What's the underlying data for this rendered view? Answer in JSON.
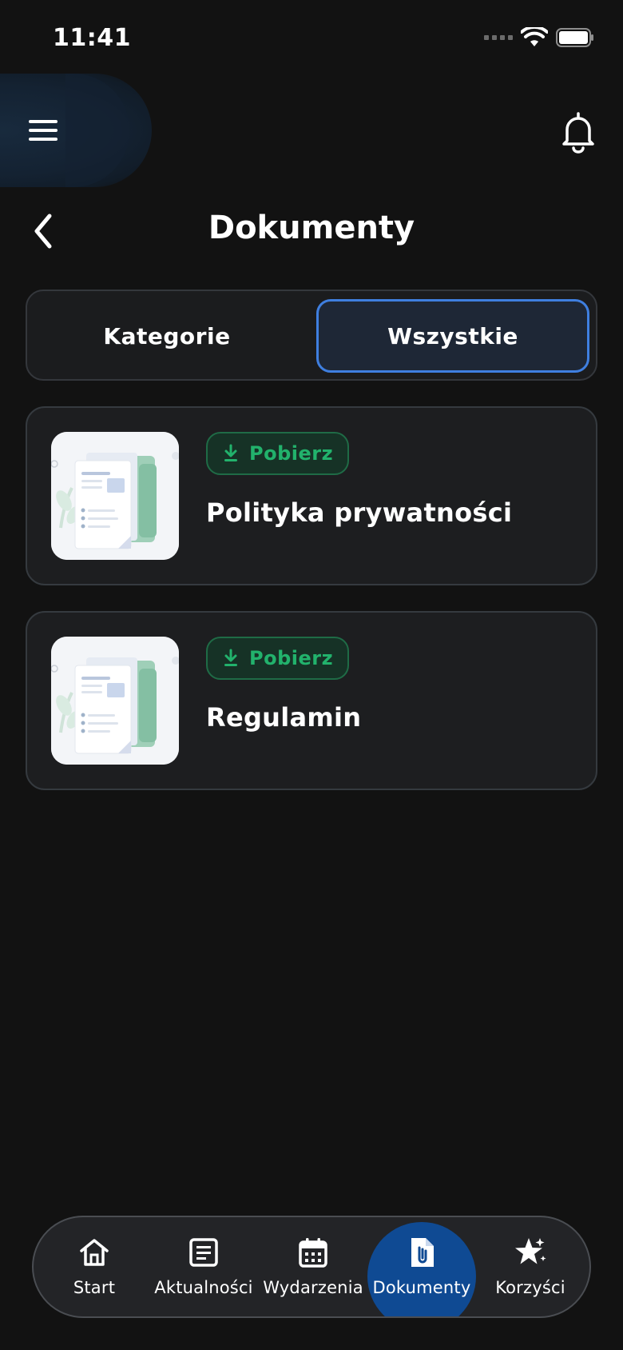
{
  "status_bar": {
    "time": "11:41"
  },
  "header": {
    "title": "Dokumenty"
  },
  "segmented": {
    "tabs": [
      {
        "label": "Kategorie",
        "selected": false
      },
      {
        "label": "Wszystkie",
        "selected": true
      }
    ]
  },
  "documents": [
    {
      "badge": "Pobierz",
      "title": "Polityka prywatności",
      "icon": "document-folder-illustration"
    },
    {
      "badge": "Pobierz",
      "title": "Regulamin",
      "icon": "document-folder-illustration"
    }
  ],
  "nav": {
    "items": [
      {
        "label": "Start",
        "icon": "home-icon"
      },
      {
        "label": "Aktualności",
        "icon": "news-icon"
      },
      {
        "label": "Wydarzenia",
        "icon": "calendar-icon"
      },
      {
        "label": "Dokumenty",
        "icon": "document-icon",
        "active": true
      },
      {
        "label": "Korzyści",
        "icon": "star-icon"
      }
    ]
  },
  "colors": {
    "background": "#121212",
    "accent": "#3f7fe0",
    "active_nav": "#0f4a93",
    "download_green": "#22b26c"
  }
}
